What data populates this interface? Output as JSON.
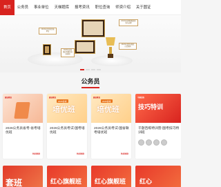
{
  "nav": {
    "items": [
      {
        "label": "首页",
        "active": true
      },
      {
        "label": "公务员",
        "active": false
      },
      {
        "label": "事业单位",
        "active": false
      },
      {
        "label": "天梯题库",
        "active": false
      },
      {
        "label": "报考资讯",
        "active": false
      },
      {
        "label": "职位查询",
        "active": false
      },
      {
        "label": "师资介绍",
        "active": false
      },
      {
        "label": "关于圆证",
        "active": false
      }
    ]
  },
  "banner": {
    "labels": [
      "2024年度全国百强单位",
      "2024年度网络教育影响力品牌",
      "2024年度省级优秀教育培训机构",
      "2024年度职业教育示范机构"
    ],
    "pagination": {
      "count": 4,
      "active": 0
    }
  },
  "section": {
    "title": "公务员"
  },
  "cards": [
    {
      "tag": "圆证教育",
      "big": "",
      "title": "2026公务员省考-省考培优班",
      "price": "¥4980",
      "theme": "#f29a6a"
    },
    {
      "tag": "圆证教育",
      "big": "培优班",
      "badge": "2026省考",
      "title": "2026公务员考试-国考培优班",
      "price": "¥4980",
      "theme": "#f3a23a"
    },
    {
      "tag": "圆证教育",
      "big": "培优班",
      "badge": "2026省考",
      "title": "2026公务员考试-国省联考培优班",
      "price": "¥4980",
      "theme": "#f3a23a"
    },
    {
      "tag": "千题百练",
      "big": "技巧特训",
      "title": "千题百练特训营-国考技巧特训班",
      "price": "¥4980",
      "theme": "#d8231f"
    }
  ],
  "bottom": [
    {
      "big": "套班"
    },
    {
      "big": "红心旗舰班"
    },
    {
      "big": "红心旗舰班"
    },
    {
      "big": "红心"
    }
  ],
  "colors": {
    "accent": "#d8231f"
  }
}
